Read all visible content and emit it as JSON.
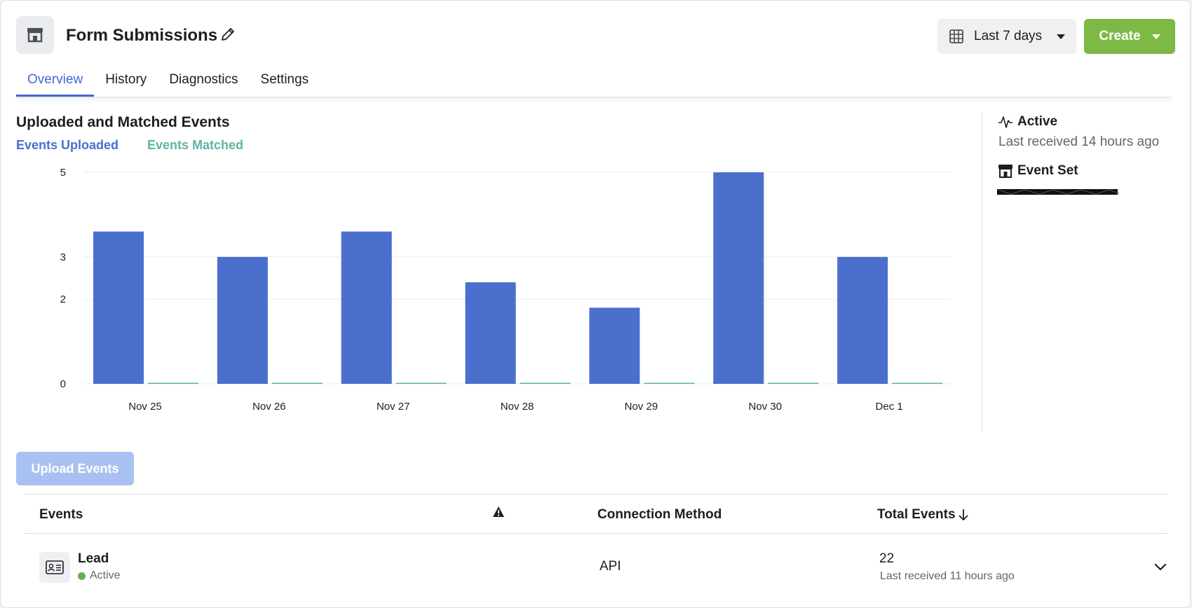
{
  "header": {
    "title": "Form Submissions",
    "date_range_label": "Last 7 days",
    "create_label": "Create"
  },
  "tabs": [
    {
      "label": "Overview",
      "active": true
    },
    {
      "label": "History",
      "active": false
    },
    {
      "label": "Diagnostics",
      "active": false
    },
    {
      "label": "Settings",
      "active": false
    }
  ],
  "chart_data": {
    "type": "bar",
    "title": "Uploaded and Matched Events",
    "categories": [
      "Nov 25",
      "Nov 26",
      "Nov 27",
      "Nov 28",
      "Nov 29",
      "Nov 30",
      "Dec 1"
    ],
    "series": [
      {
        "name": "Events Uploaded",
        "color": "#4b6fcc",
        "values": [
          3.6,
          3,
          3.6,
          2.4,
          1.8,
          5,
          3
        ]
      },
      {
        "name": "Events Matched",
        "color": "#5db4a4",
        "values": [
          0,
          0,
          0,
          0,
          0,
          0,
          0
        ]
      }
    ],
    "y_ticks": [
      "0",
      "2",
      "3",
      "5"
    ],
    "ylim": [
      0,
      5
    ],
    "grid": true,
    "legend_placement": "top-left"
  },
  "side_panel": {
    "status_title": "Active",
    "status_detail": "Last received 14 hours ago",
    "event_set_title": "Event Set"
  },
  "upload_button_label": "Upload Events",
  "table": {
    "columns": {
      "events": "Events",
      "connection_method": "Connection Method",
      "total_events": "Total Events"
    },
    "rows": [
      {
        "name": "Lead",
        "status": "Active",
        "connection_method": "API",
        "total": "22",
        "last_received": "Last received 11 hours ago"
      }
    ]
  }
}
